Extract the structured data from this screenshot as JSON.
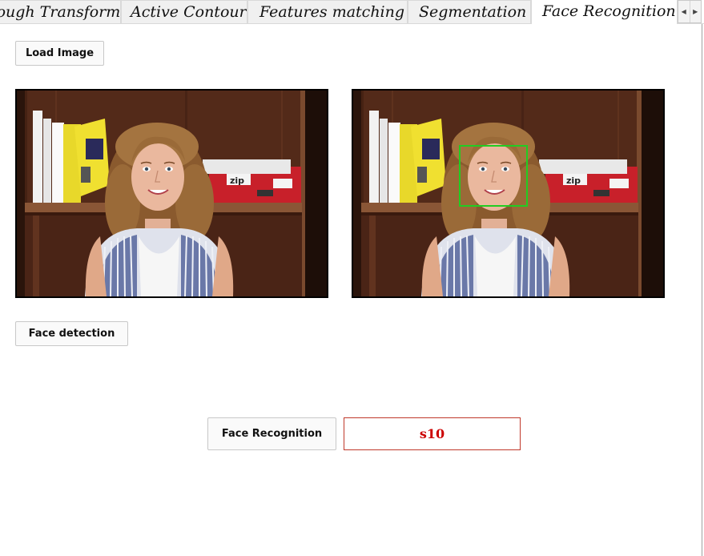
{
  "tabs": [
    {
      "label": "Hough Transform",
      "active": false
    },
    {
      "label": "Active Contour",
      "active": false
    },
    {
      "label": "Features matching",
      "active": false
    },
    {
      "label": "Segmentation",
      "active": false
    },
    {
      "label": "Face Recognition",
      "active": true
    }
  ],
  "tab_scroll": {
    "left_icon": "triangle-left",
    "right_icon": "triangle-right"
  },
  "buttons": {
    "load_image": "Load Image",
    "face_detection": "Face detection",
    "face_recognition": "Face Recognition"
  },
  "images": {
    "input": {
      "description_icon": "photo",
      "detection_box": false
    },
    "output": {
      "description_icon": "photo",
      "detection_box": true,
      "box_color": "#22cc22"
    }
  },
  "result": {
    "value": "s10",
    "color": "#cc0000",
    "border_color": "#c0392b"
  }
}
